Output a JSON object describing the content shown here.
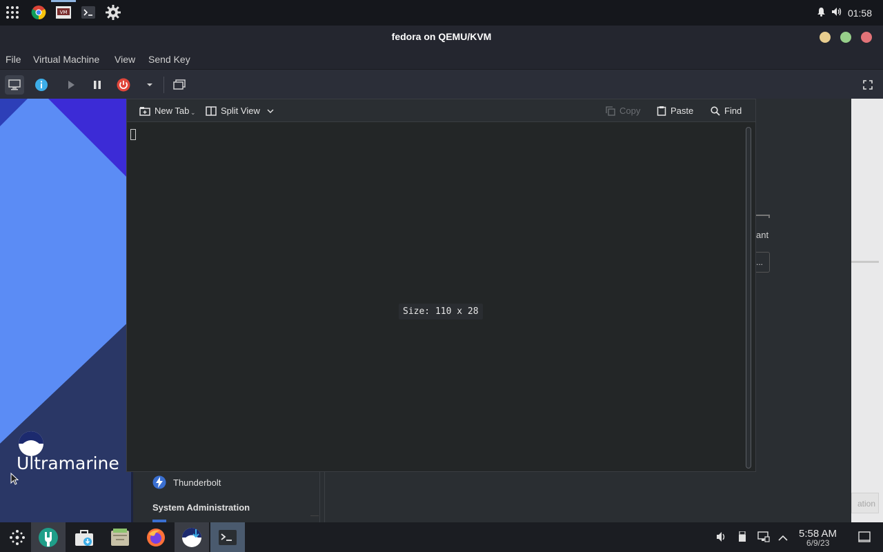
{
  "host_panel": {
    "clock": "01:58",
    "icons": [
      "app-grid-icon",
      "chrome-icon",
      "virt-manager-icon",
      "terminal-icon",
      "settings-icon",
      "bell-icon",
      "volume-icon"
    ]
  },
  "vm_window": {
    "title": "fedora on QEMU/KVM",
    "menu": [
      "File",
      "Virtual Machine",
      "View",
      "Send Key"
    ]
  },
  "konsole": {
    "new_tab": "New Tab",
    "split_view": "Split View",
    "copy": "Copy",
    "paste": "Paste",
    "find": "Find",
    "size_tooltip": "Size: 110 x 28"
  },
  "settings_behind": {
    "item_thunderbolt": "Thunderbolt",
    "section_system_admin": "System Administration",
    "partial_text": "ant",
    "partial_button": "...",
    "partial_right": "ation"
  },
  "wallpaper": {
    "brand": "Ultramarine"
  },
  "guest_taskbar": {
    "time": "5:58 AM",
    "date": "6/9/23"
  },
  "colors": {
    "wallpaper_blue": "#5b8cf5",
    "wallpaper_dark": "#1c2340",
    "wallpaper_purple": "#3c2bd6",
    "accent": "#3daee9",
    "power_red": "#e0463b"
  }
}
